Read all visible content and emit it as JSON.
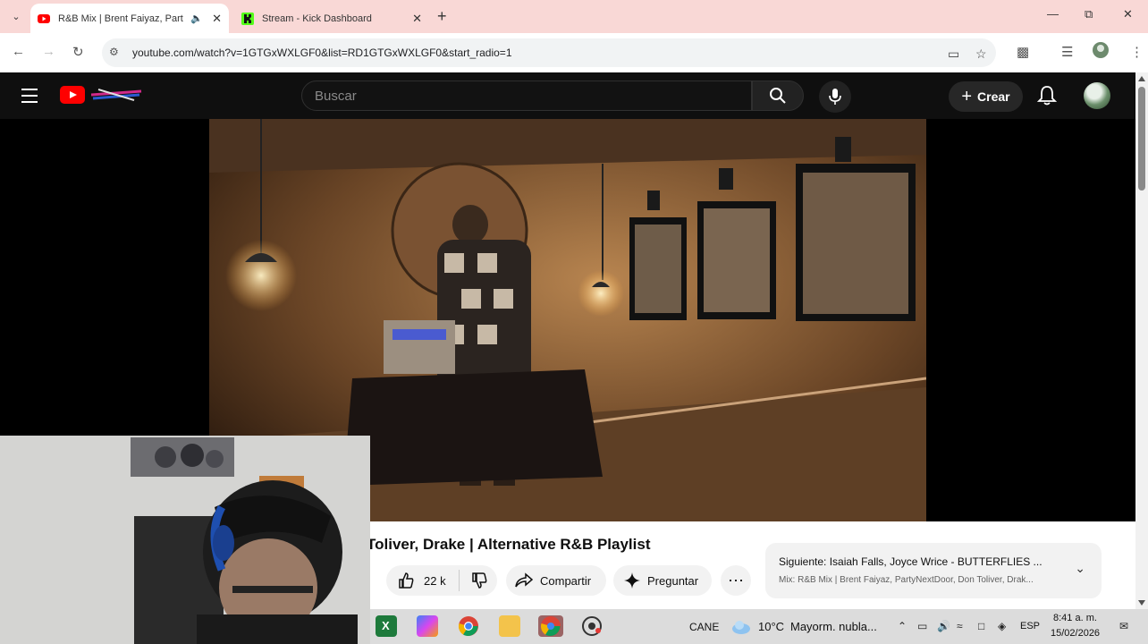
{
  "browser": {
    "tabs": [
      {
        "title": "R&B Mix | Brent Faiyaz, Part",
        "active": true,
        "favicon": "youtube-icon",
        "audio_icon": "speaker-icon"
      },
      {
        "title": "Stream - Kick Dashboard",
        "active": false,
        "favicon": "kick-icon"
      }
    ],
    "url": "youtube.com/watch?v=1GTGxWXLGF0&list=RD1GTGxWXLGF0&start_radio=1"
  },
  "youtube": {
    "search_placeholder": "Buscar",
    "create_label": "Crear",
    "video_title": "Toliver, Drake | Alternative R&B Playlist",
    "like_count": "22 k",
    "share_label": "Compartir",
    "ask_label": "Preguntar",
    "next_up_title": "Siguiente: Isaiah Falls, Joyce Wrice - BUTTERFLIES ...",
    "next_up_subtitle": "Mix: R&B Mix | Brent Faiyaz, PartyNextDoor, Don Toliver, Drak..."
  },
  "taskbar": {
    "label": "CANE",
    "weather": "10°C",
    "weather_desc": "Mayorm. nubla...",
    "language": "ESP",
    "time": "8:41 a. m.",
    "date": "15/02/2026"
  },
  "colors": {
    "youtube_red": "#ff0000",
    "tabbar_bg": "#f9d8d6",
    "page_bg": "#0f0f0f"
  }
}
